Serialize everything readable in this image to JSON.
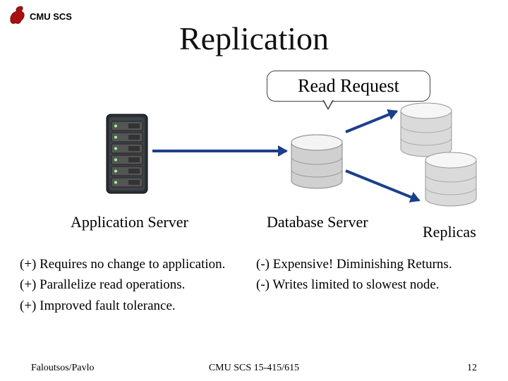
{
  "header": {
    "org": "CMU SCS"
  },
  "title": "Replication",
  "bubble": "Read Request",
  "labels": {
    "app": "Application Server",
    "db": "Database Server",
    "rep": "Replicas"
  },
  "pros": [
    "(+)  Requires no change to application.",
    "(+)  Parallelize read operations.",
    "(+)  Improved fault tolerance."
  ],
  "cons": [
    "(-)  Expensive! Diminishing Returns.",
    "(-)  Writes limited to slowest node."
  ],
  "footer": {
    "left": "Faloutsos/Pavlo",
    "center": "CMU SCS 15-415/615",
    "right": "12"
  }
}
